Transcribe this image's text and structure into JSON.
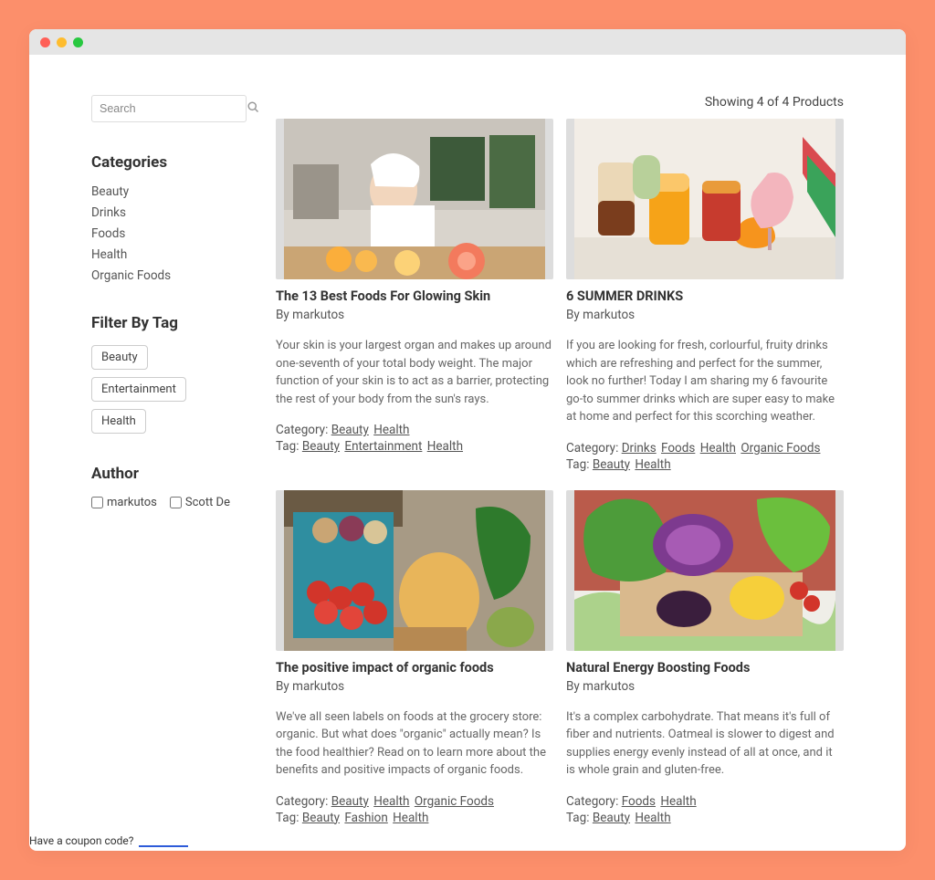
{
  "search": {
    "placeholder": "Search"
  },
  "sidebar": {
    "categories_heading": "Categories",
    "categories": [
      "Beauty",
      "Drinks",
      "Foods",
      "Health",
      "Organic Foods"
    ],
    "filter_heading": "Filter By Tag",
    "tags": [
      "Beauty",
      "Entertainment",
      "Health"
    ],
    "author_heading": "Author",
    "authors": [
      "markutos",
      "Scott De"
    ]
  },
  "main": {
    "showing": "Showing 4 of 4 Products",
    "category_label": "Category:",
    "tag_label": "Tag:",
    "by_prefix": "By ",
    "posts": [
      {
        "title": "The 13 Best Foods For Glowing Skin",
        "author": "markutos",
        "excerpt": "Your skin is your largest organ and makes up around one-seventh of your total body weight. The major function of your skin is to act as a barrier, protecting the rest of your body from the sun's rays.",
        "categories": [
          "Beauty",
          "Health"
        ],
        "tags": [
          "Beauty",
          "Entertainment",
          "Health"
        ],
        "thumb": "skincare"
      },
      {
        "title": "6 SUMMER DRINKS",
        "author": "markutos",
        "excerpt": "If you are looking for fresh, corlourful, fruity drinks which are refreshing and perfect for the summer, look no further! Today I am sharing my 6 favourite go-to summer drinks which are super easy to make at home and perfect for this scorching weather.",
        "categories": [
          "Drinks",
          "Foods",
          "Health",
          "Organic Foods"
        ],
        "tags": [
          "Beauty",
          "Health"
        ],
        "thumb": "drinks"
      },
      {
        "title": "The positive impact of organic foods",
        "author": "markutos",
        "excerpt": "We've all seen labels on foods at the grocery store: organic. But what does \"organic\" actually mean? Is the food healthier? Read on to learn more about the benefits and positive impacts of organic foods.",
        "categories": [
          "Beauty",
          "Health",
          "Organic Foods"
        ],
        "tags": [
          "Beauty",
          "Fashion",
          "Health"
        ],
        "thumb": "veggies"
      },
      {
        "title": "Natural Energy Boosting Foods",
        "author": "markutos",
        "excerpt": "It's a complex carbohydrate. That means it's full of fiber and nutrients. Oatmeal is slower to digest and supplies energy evenly instead of all at once, and it is whole grain and gluten-free.",
        "categories": [
          "Foods",
          "Health"
        ],
        "tags": [
          "Beauty",
          "Health"
        ],
        "thumb": "basket"
      }
    ]
  },
  "coupon": "Have a coupon code?"
}
